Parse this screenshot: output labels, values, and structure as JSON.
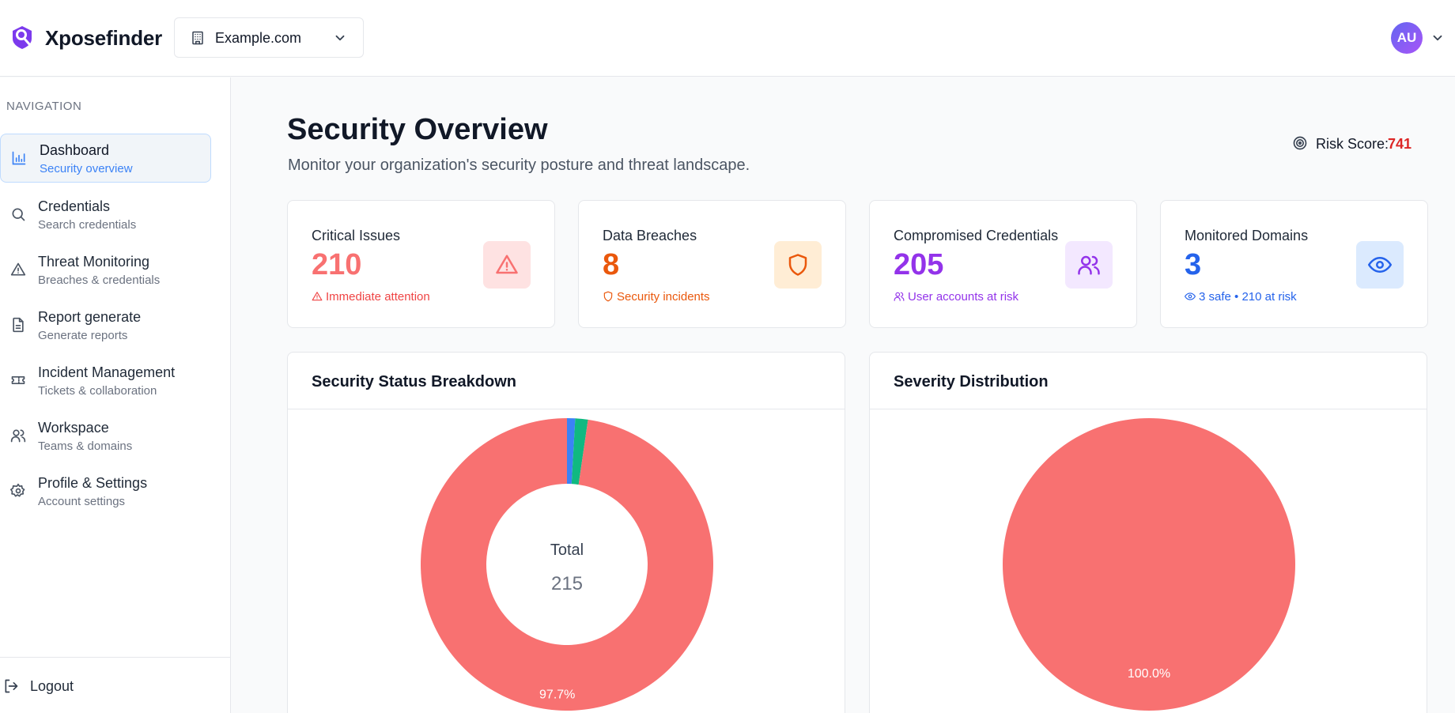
{
  "header": {
    "brand": "Xposefinder",
    "domain_selector": {
      "value": "Example.com"
    },
    "avatar_initials": "AU"
  },
  "sidebar": {
    "heading": "NAVIGATION",
    "items": [
      {
        "title": "Dashboard",
        "subtitle": "Security overview",
        "icon": "bar-chart-icon",
        "active": true
      },
      {
        "title": "Credentials",
        "subtitle": "Search credentials",
        "icon": "search-icon"
      },
      {
        "title": "Threat Monitoring",
        "subtitle": "Breaches & credentials",
        "icon": "warning-icon"
      },
      {
        "title": "Report generate",
        "subtitle": "Generate reports",
        "icon": "document-icon"
      },
      {
        "title": "Incident Management",
        "subtitle": "Tickets & collaboration",
        "icon": "ticket-icon"
      },
      {
        "title": "Workspace",
        "subtitle": "Teams & domains",
        "icon": "users-icon"
      },
      {
        "title": "Profile & Settings",
        "subtitle": "Account settings",
        "icon": "gear-icon"
      }
    ],
    "logout": "Logout"
  },
  "main": {
    "title": "Security Overview",
    "subtitle": "Monitor your organization's security posture and threat landscape.",
    "risk_label": "Risk Score:",
    "risk_value": "741",
    "cards": [
      {
        "title": "Critical Issues",
        "value": "210",
        "note": "Immediate attention",
        "icon": "alert-triangle-icon",
        "color": "#f87171",
        "badge_bg": "#fee2e2"
      },
      {
        "title": "Data Breaches",
        "value": "8",
        "note": "Security incidents",
        "icon": "shield-icon",
        "color": "#ea580c",
        "badge_bg": "#ffedd5"
      },
      {
        "title": "Compromised Credentials",
        "value": "205",
        "note": "User accounts at risk",
        "icon": "users-icon",
        "color": "#9333ea",
        "badge_bg": "#f3e8ff"
      },
      {
        "title": "Monitored Domains",
        "value": "3",
        "note": "3 safe • 210 at risk",
        "icon": "eye-icon",
        "color": "#2563eb",
        "badge_bg": "#dbeafe"
      }
    ],
    "panels": [
      {
        "title": "Security Status Breakdown"
      },
      {
        "title": "Severity Distribution"
      }
    ]
  },
  "chart_data": [
    {
      "type": "pie",
      "variant": "donut",
      "title": "Security Status Breakdown",
      "center_label": "Total",
      "center_value": "215",
      "slices": [
        {
          "value": 97.7,
          "color": "#f87171",
          "label": "97.7%"
        },
        {
          "value": 0.9,
          "color": "#3b82f6"
        },
        {
          "value": 1.4,
          "color": "#10b981"
        }
      ]
    },
    {
      "type": "pie",
      "title": "Severity Distribution",
      "slices": [
        {
          "value": 100.0,
          "color": "#f87171",
          "label": "100.0%"
        }
      ]
    }
  ]
}
